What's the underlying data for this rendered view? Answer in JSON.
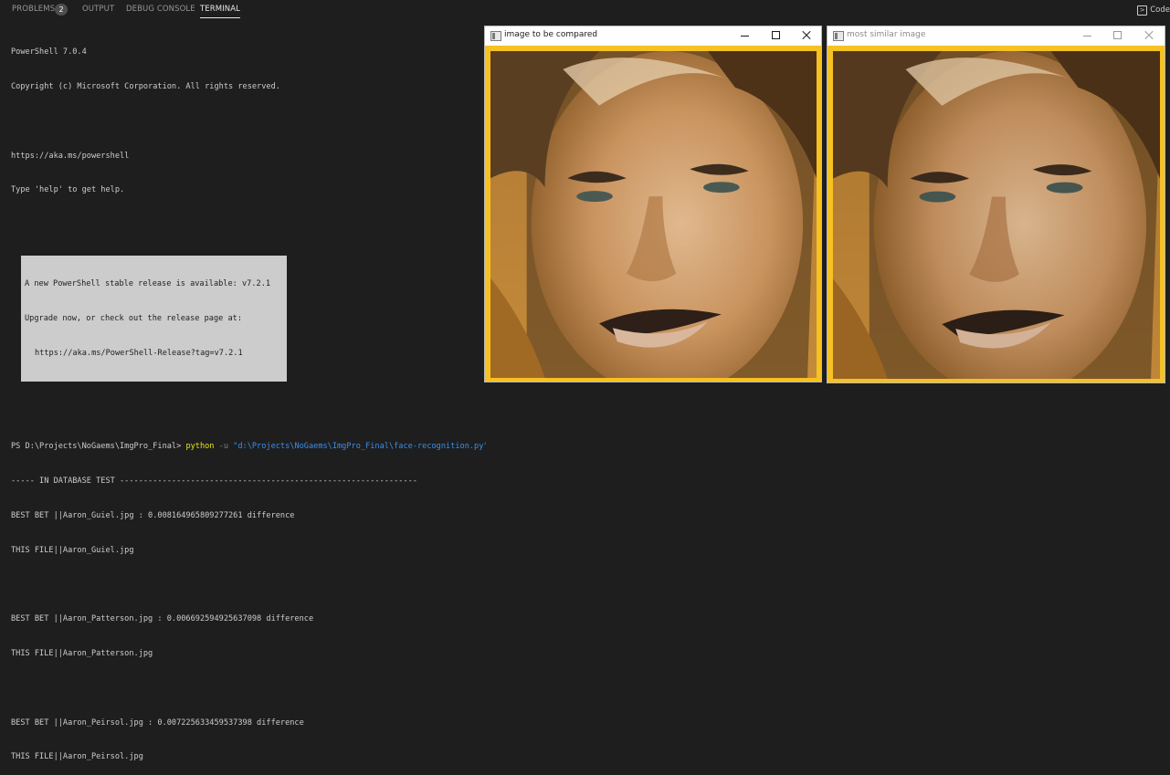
{
  "panel": {
    "tabs": [
      {
        "label": "PROBLEMS",
        "active": false
      },
      {
        "label": "OUTPUT",
        "active": false
      },
      {
        "label": "DEBUG CONSOLE",
        "active": false
      },
      {
        "label": "TERMINAL",
        "active": true
      }
    ],
    "problems_count": "2",
    "launch_label": "Code",
    "launch_icon": "terminal-launch-icon"
  },
  "terminal": {
    "lines": [
      "PowerShell 7.0.4",
      "Copyright (c) Microsoft Corporation. All rights reserved.",
      "",
      "https://aka.ms/powershell",
      "Type 'help' to get help."
    ],
    "notice": [
      "A new PowerShell stable release is available: v7.2.1",
      "Upgrade now, or check out the release page at:",
      "https://aka.ms/PowerShell-Release?tag=v7.2.1"
    ],
    "prompt": "PS D:\\Projects\\NoGaems\\ImgPro_Final> ",
    "command_python": "python",
    "command_flag": " -u ",
    "command_path": "\"d:\\Projects\\NoGaems\\ImgPro_Final\\face-recognition.py\"",
    "output": [
      "----- IN DATABASE TEST ---------------------------------------------------------------",
      "BEST BET ||Aaron_Guiel.jpg : 0.008164965809277261 difference",
      "THIS FILE||Aaron_Guiel.jpg",
      "",
      "BEST BET ||Aaron_Patterson.jpg : 0.006692594925637098 difference",
      "THIS FILE||Aaron_Patterson.jpg",
      "",
      "BEST BET ||Aaron_Peirsol.jpg : 0.007225633459537398 difference",
      "THIS FILE||Aaron_Peirsol.jpg"
    ]
  },
  "windows": [
    {
      "title": "image to be compared",
      "active": true
    },
    {
      "title": "most similar image",
      "active": false
    }
  ],
  "colors": {
    "terminal_bg": "#1e1e1e",
    "terminal_fg": "#cccccc",
    "python_keyword": "#e5e510",
    "string_path": "#3b8eea",
    "image_border": "#f6c122"
  },
  "icons": {
    "window_app": "opencv-window-icon",
    "minimize": "minimize-icon",
    "maximize": "maximize-icon",
    "close": "close-icon"
  }
}
